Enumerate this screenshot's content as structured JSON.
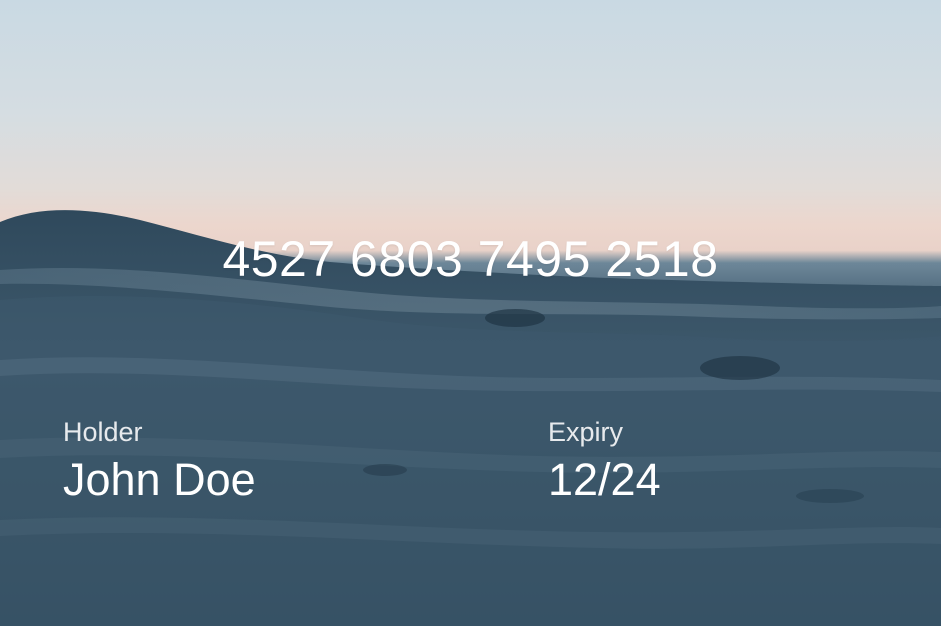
{
  "card": {
    "number": "4527 6803 7495 2518",
    "holder_label": "Holder",
    "holder_name": "John Doe",
    "expiry_label": "Expiry",
    "expiry_value": "12/24"
  },
  "background": {
    "description_icon": "ocean-wave-image",
    "sky_color": "#c9d9e3",
    "horizon_color": "#ecd6cd",
    "water_color": "#34505f"
  }
}
